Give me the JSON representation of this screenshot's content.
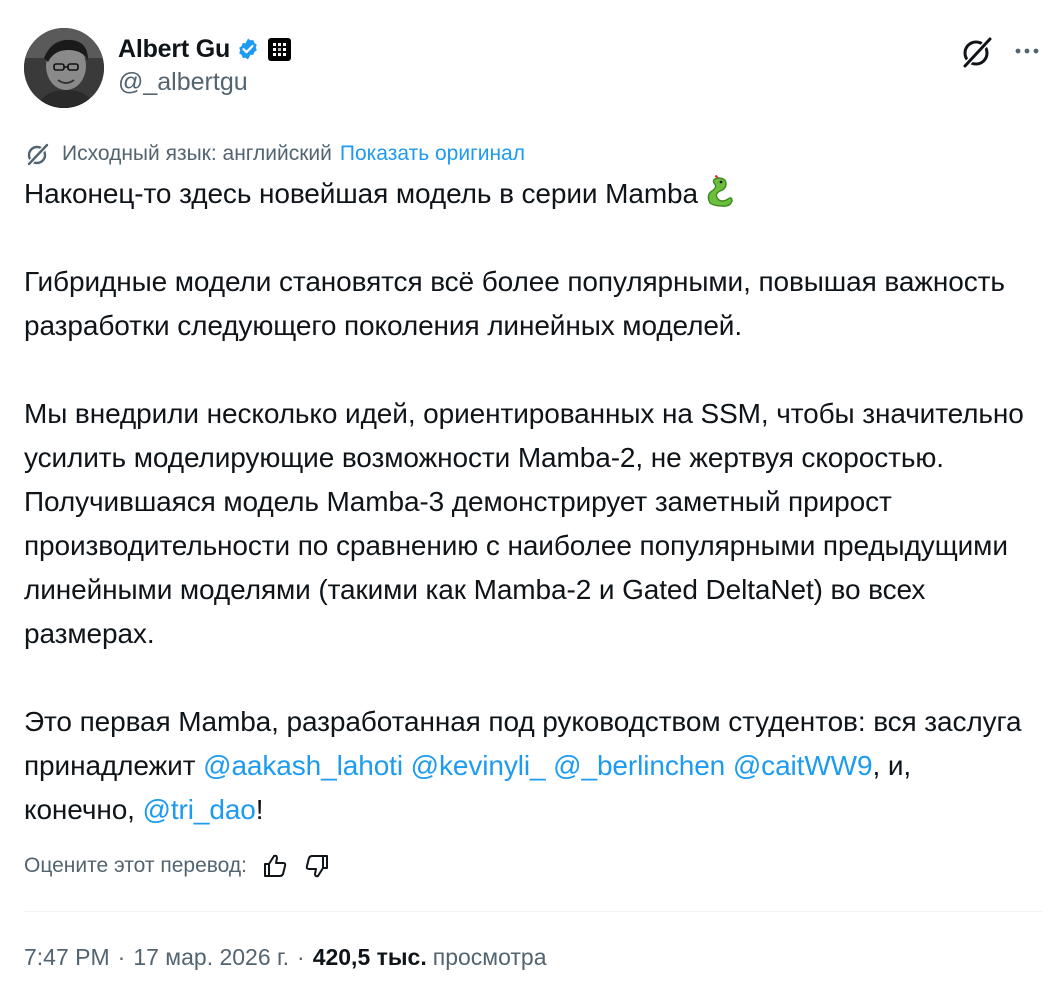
{
  "author": {
    "display_name": "Albert Gu",
    "handle": "@_albertgu"
  },
  "icons": {
    "verified": "verified-badge-icon",
    "affiliation": "affiliation-logo-icon",
    "grok": "grok-icon",
    "more": "more-options-icon",
    "translate": "translate-icon",
    "thumbs_up": "thumbs-up-icon",
    "thumbs_down": "thumbs-down-icon",
    "snake_emoji": "snake-emoji-icon"
  },
  "colors": {
    "link": "#1d9bf0",
    "verified": "#1d9bf0",
    "secondary_text": "#536471",
    "primary_text": "#0f1419"
  },
  "translation": {
    "source_label": "Исходный язык: английский",
    "show_original": "Показать оригинал"
  },
  "body": {
    "p1": "Наконец-то здесь новейшая модель в серии Mamba",
    "p2": "Гибридные модели становятся всё более популярными, повышая важность разработки следующего поколения линейных моделей.",
    "p3": "Мы внедрили несколько идей, ориентированных на SSM, чтобы значительно усилить моделирующие возможности Mamba-2, не жертвуя скоростью. Получившаяся модель Mamba-3 демонстрирует заметный прирост производительности по сравнению с наиболее популярными предыдущими линейными моделями (такими как Mamba-2 и Gated DeltaNet) во всех размерах.",
    "p4_intro": "Это первая Mamba, разработанная под руководством студентов: вся заслуга принадлежит",
    "mentions": [
      "@aakash_lahoti",
      "@kevinyli_",
      "@_berlinchen",
      "@caitWW9"
    ],
    "p4_conj": ", и, конечно,",
    "mention_last": "@tri_dao",
    "p4_end": "!"
  },
  "rating": {
    "label": "Оцените этот перевод:"
  },
  "meta": {
    "time": "7:47 PM",
    "date": "17 мар. 2026 г.",
    "separator": "·",
    "views_count": "420,5 тыс.",
    "views_label": "просмотра"
  }
}
